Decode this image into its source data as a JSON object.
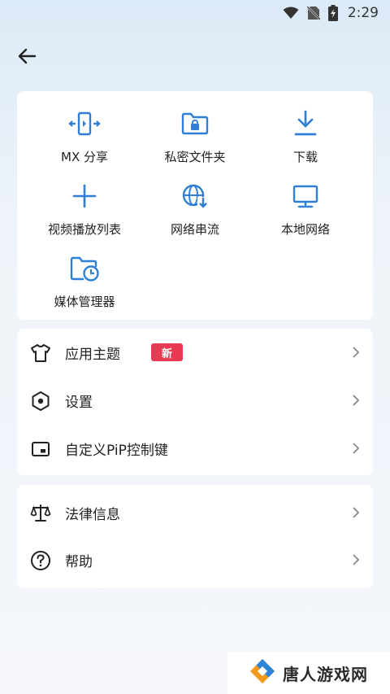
{
  "status_bar": {
    "time": "2:29"
  },
  "grid": [
    {
      "label": "MX 分享",
      "icon": "mx-share-icon"
    },
    {
      "label": "私密文件夹",
      "icon": "private-folder-icon"
    },
    {
      "label": "下载",
      "icon": "download-icon"
    },
    {
      "label": "视频播放列表",
      "icon": "add-playlist-icon"
    },
    {
      "label": "网络串流",
      "icon": "network-stream-icon"
    },
    {
      "label": "本地网络",
      "icon": "local-network-icon"
    },
    {
      "label": "媒体管理器",
      "icon": "media-manager-icon"
    }
  ],
  "menu_main": [
    {
      "label": "应用主题",
      "badge": "新",
      "icon": "tshirt-icon"
    },
    {
      "label": "设置",
      "icon": "settings-hexagon-icon"
    },
    {
      "label": "自定义PiP控制键",
      "icon": "pip-icon"
    }
  ],
  "menu_secondary": [
    {
      "label": "法律信息",
      "icon": "scale-icon"
    },
    {
      "label": "帮助",
      "icon": "help-icon"
    }
  ],
  "watermark": {
    "text": "唐人游戏网"
  },
  "colors": {
    "accent": "#2f7fd6",
    "badge": "#e83a52",
    "card": "#ffffff"
  }
}
